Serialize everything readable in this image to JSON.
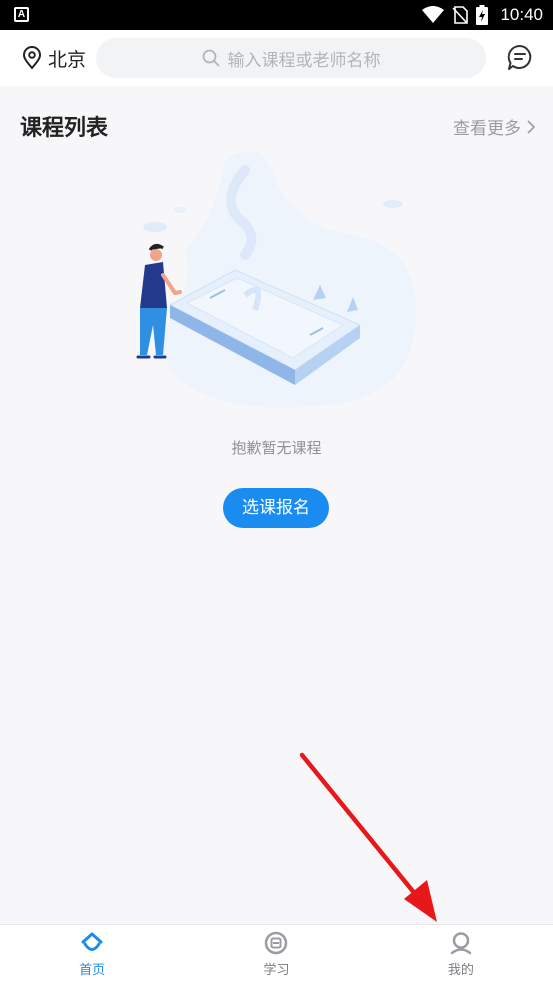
{
  "status_bar": {
    "app_icon": "A",
    "time": "10:40",
    "icons": [
      "wifi-icon",
      "no-sim-icon",
      "battery-charging-icon"
    ]
  },
  "top_bar": {
    "location": "北京",
    "search_placeholder": "输入课程或老师名称",
    "icons": [
      "location-pin-icon",
      "search-icon",
      "message-icon"
    ]
  },
  "section": {
    "title": "课程列表",
    "see_more": "查看更多"
  },
  "empty_state": {
    "message": "抱歉暂无课程",
    "button": "选课报名"
  },
  "tab_bar": {
    "tabs": [
      {
        "label": "首页",
        "icon": "home-icon",
        "active": true
      },
      {
        "label": "学习",
        "icon": "study-icon",
        "active": false
      },
      {
        "label": "我的",
        "icon": "profile-icon",
        "active": false
      }
    ]
  },
  "colors": {
    "accent": "#1a8cf0",
    "background": "#f7f7fa",
    "annotation": "#e8171a"
  }
}
